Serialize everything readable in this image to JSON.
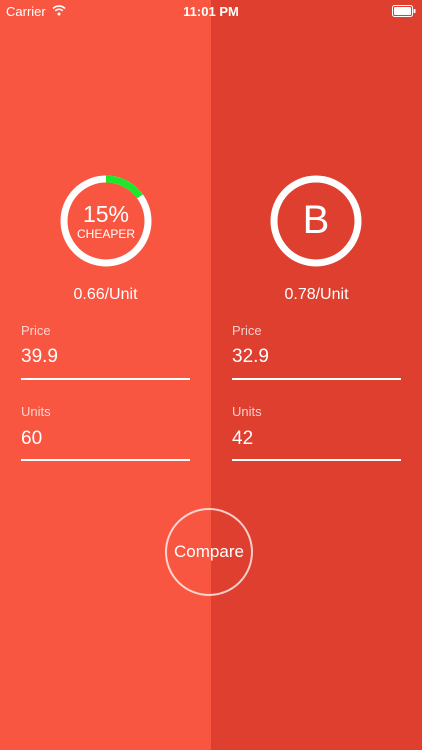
{
  "status_bar": {
    "carrier": "Carrier",
    "time": "11:01 PM",
    "icons": [
      "wifi-icon",
      "battery-icon"
    ]
  },
  "colors": {
    "left_panel": "#f95642",
    "right_panel": "#df3f2f",
    "progress_accent": "#1ee62a",
    "text": "#ffffff"
  },
  "item_a": {
    "percent": "15%",
    "label": "CHEAPER",
    "savings_fraction": 0.15,
    "unit_price": "0.66/Unit",
    "price_label": "Price",
    "price_value": "39.9",
    "units_label": "Units",
    "units_value": "60"
  },
  "item_b": {
    "letter": "B",
    "unit_price": "0.78/Unit",
    "price_label": "Price",
    "price_value": "32.9",
    "units_label": "Units",
    "units_value": "42"
  },
  "compare_label": "Compare"
}
